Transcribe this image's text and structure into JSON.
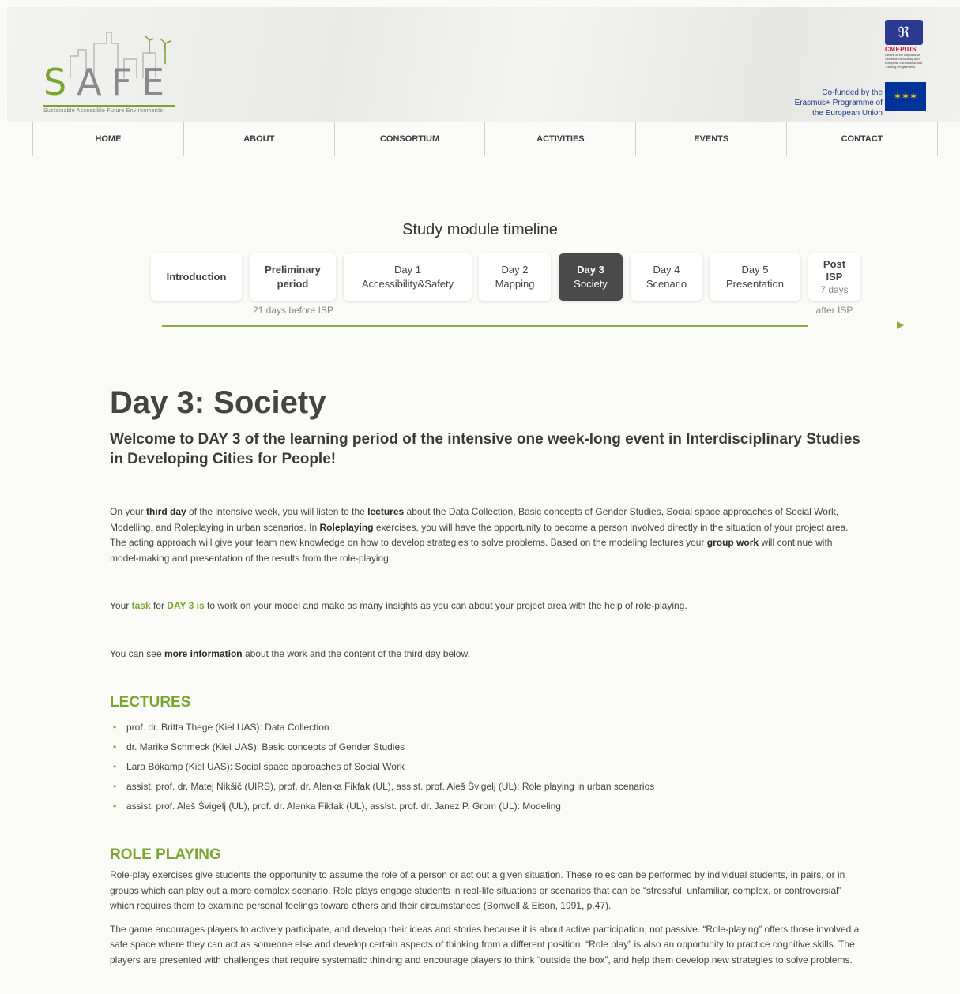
{
  "header": {
    "logo_text": "SAFE",
    "logo_tagline": "Sustainable  Accessible  Future  Environments",
    "partner_logo_name": "CMEPIUS",
    "partner_logo_sub": "Centre of the Republic of Slovenia for Mobility and European Educational and Training Programmes",
    "eu_text": "Co-funded by the Erasmus+ Programme of the European Union"
  },
  "nav": [
    "HOME",
    "ABOUT",
    "CONSORTIUM",
    "ACTIVITIES",
    "EVENTS",
    "CONTACT"
  ],
  "timeline": {
    "title": "Study module timeline",
    "items": [
      {
        "line1": "Introduction",
        "line2": ""
      },
      {
        "line1": "Preliminary",
        "line2": "period"
      },
      {
        "line1": "Day 1",
        "line2": "Accessibility&Safety"
      },
      {
        "line1": "Day 2",
        "line2": "Mapping"
      },
      {
        "line1": "Day 3",
        "line2": "Society"
      },
      {
        "line1": "Day 4",
        "line2": "Scenario"
      },
      {
        "line1": "Day 5",
        "line2": "Presentation"
      },
      {
        "line1": "Post",
        "line2": "ISP",
        "line3": "7 days"
      }
    ],
    "note_preliminary": "21 days before ISP",
    "note_post": "after ISP"
  },
  "main": {
    "title": "Day 3: Society",
    "welcome": "Welcome to DAY 3 of the learning period of the intensive one week-long event in Interdisciplinary Studies in Developing Cities for People!",
    "para1": {
      "t1": "On your ",
      "b1": "third day",
      "t2": " of the intensive week, you will listen to the ",
      "b2": "lectures",
      "t3": " about the Data Collection, Basic concepts of Gender Studies, Social space approaches of Social Work, Modelling, and Roleplaying in urban scenarios. In ",
      "b3": "Roleplaying",
      "t4": " exercises, you will have the opportunity to become a person involved directly in the situation of your project area. The acting approach will give your team new knowledge on how to develop strategies to solve problems. Based on the modeling lectures your ",
      "b4": "group work",
      "t5": " will continue with model-making and presentation of the results from the role-playing."
    },
    "para2": {
      "t1": "Your ",
      "g1": "task",
      "t2": " for ",
      "g2": "DAY 3 is",
      "t3": " to work on your model and make as many insights as you can about your project area with the help of role-playing."
    },
    "para3": {
      "t1": "You can see ",
      "b1": "more information",
      "t2": " about the work and the content of the third day below."
    },
    "lectures_title": "LECTURES",
    "lectures": [
      "prof. dr. Britta Thege (Kiel UAS): Data Collection",
      "dr. Marike Schmeck (Kiel UAS): Basic concepts of Gender Studies",
      "Lara Bökamp (Kiel UAS): Social space approaches of Social Work",
      "assist. prof. dr. Matej Nikšič (UIRS), prof. dr. Alenka Fikfak (UL), assist. prof. Aleš Švigelj (UL):  Role playing in urban scenarios",
      "assist. prof. Aleš Švigelj (UL), prof. dr. Alenka Fikfak (UL), assist. prof. dr. Janez P. Grom (UL):  Modeling"
    ],
    "roleplay_title": "ROLE PLAYING",
    "roleplay_p1": "Role-play exercises give students the opportunity to assume the role of a person or act out a given situation. These roles can be performed by individual students, in pairs, or in groups which can play out a more complex scenario. Role plays engage students in real-life situations or scenarios that can be “stressful, unfamiliar, complex, or controversial” which requires them to examine personal feelings toward others and their circumstances (Bonwell & Eison, 1991, p.47).",
    "roleplay_p2": "The game encourages players to actively participate, and develop their ideas and stories because it is about active participation, not passive. “Role-playing” offers those involved a safe space where they can act as someone else and develop certain aspects of thinking from a different position. “Role play” is also an opportunity to practice cognitive skills. The players are presented with challenges that require systematic thinking and encourage players to think “outside the box”, and help them develop new strategies to solve problems."
  },
  "colors": {
    "accent_green": "#7ba431",
    "active_tab": "#4a4a4a"
  }
}
